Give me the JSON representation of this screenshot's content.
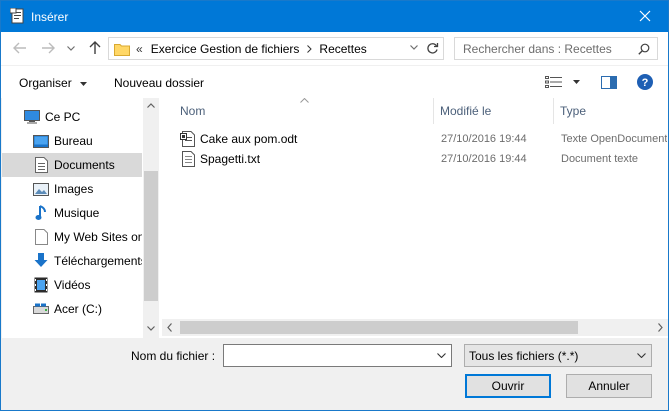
{
  "window": {
    "title": "Insérer"
  },
  "address": {
    "prefix": "«",
    "path": [
      "Exercice Gestion de fichiers",
      "Recettes"
    ]
  },
  "search": {
    "placeholder": "Rechercher dans : Recettes"
  },
  "toolbar": {
    "organize_label": "Organiser",
    "new_folder_label": "Nouveau dossier"
  },
  "sidebar": {
    "items": [
      {
        "label": "Ce PC",
        "icon": "computer-icon"
      },
      {
        "label": "Bureau",
        "icon": "desktop-icon"
      },
      {
        "label": "Documents",
        "icon": "documents-icon",
        "selected": true
      },
      {
        "label": "Images",
        "icon": "images-icon"
      },
      {
        "label": "Musique",
        "icon": "music-icon"
      },
      {
        "label": "My Web Sites on",
        "icon": "web-sites-icon"
      },
      {
        "label": "Téléchargements",
        "icon": "downloads-icon"
      },
      {
        "label": "Vidéos",
        "icon": "videos-icon"
      },
      {
        "label": "Acer (C:)",
        "icon": "drive-icon"
      }
    ]
  },
  "columns": {
    "name": "Nom",
    "modified": "Modifié le",
    "type": "Type"
  },
  "files": [
    {
      "name": "Cake aux pom.odt",
      "modified": "27/10/2016 19:44",
      "type": "Texte OpenDocument"
    },
    {
      "name": "Spagetti.txt",
      "modified": "27/10/2016 19:44",
      "type": "Document texte"
    }
  ],
  "footer": {
    "filename_label": "Nom du fichier :",
    "filename_value": "",
    "filetype_value": "Tous les fichiers (*.*)",
    "open_label": "Ouvrir",
    "cancel_label": "Annuler"
  },
  "colors": {
    "titlebar": "#0078d7",
    "accent": "#0078d7",
    "selection": "#d9d9d9",
    "folder": "#ffd766"
  }
}
